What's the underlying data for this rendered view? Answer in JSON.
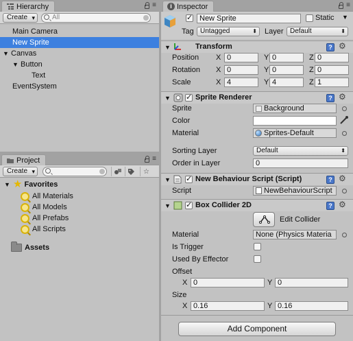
{
  "hierarchy": {
    "tab_label": "Hierarchy",
    "create_label": "Create",
    "search_placeholder": "All",
    "items": [
      {
        "label": "Main Camera",
        "indent": 0,
        "selected": false,
        "expander": ""
      },
      {
        "label": "New Sprite",
        "indent": 0,
        "selected": true,
        "expander": ""
      },
      {
        "label": "Canvas",
        "indent": 0,
        "selected": false,
        "expander": "▼"
      },
      {
        "label": "Button",
        "indent": 1,
        "selected": false,
        "expander": "▼"
      },
      {
        "label": "Text",
        "indent": 2,
        "selected": false,
        "expander": ""
      },
      {
        "label": "EventSystem",
        "indent": 0,
        "selected": false,
        "expander": ""
      }
    ]
  },
  "project": {
    "tab_label": "Project",
    "create_label": "Create",
    "favorites_label": "Favorites",
    "favorites": [
      "All Materials",
      "All Models",
      "All Prefabs",
      "All Scripts"
    ],
    "assets_label": "Assets"
  },
  "inspector": {
    "tab_label": "Inspector",
    "object_name": "New Sprite",
    "static_label": "Static",
    "tag_label": "Tag",
    "tag_value": "Untagged",
    "layer_label": "Layer",
    "layer_value": "Default",
    "transform": {
      "title": "Transform",
      "position_label": "Position",
      "rotation_label": "Rotation",
      "scale_label": "Scale",
      "position": {
        "x": "0",
        "y": "0",
        "z": "0"
      },
      "rotation": {
        "x": "0",
        "y": "0",
        "z": "0"
      },
      "scale": {
        "x": "4",
        "y": "4",
        "z": "1"
      }
    },
    "sprite_renderer": {
      "title": "Sprite Renderer",
      "sprite_label": "Sprite",
      "sprite_value": "Background",
      "color_label": "Color",
      "color_value": "#ffffff",
      "material_label": "Material",
      "material_value": "Sprites-Default",
      "sorting_layer_label": "Sorting Layer",
      "sorting_layer_value": "Default",
      "order_label": "Order in Layer",
      "order_value": "0"
    },
    "script_comp": {
      "title": "New Behaviour Script (Script)",
      "script_label": "Script",
      "script_value": "NewBehaviourScript"
    },
    "box_collider": {
      "title": "Box Collider 2D",
      "edit_label": "Edit Collider",
      "material_label": "Material",
      "material_value": "None (Physics Materia",
      "is_trigger_label": "Is Trigger",
      "used_by_effector_label": "Used By Effector",
      "offset_label": "Offset",
      "offset": {
        "x": "0",
        "y": "0"
      },
      "size_label": "Size",
      "size": {
        "x": "0.16",
        "y": "0.16"
      }
    },
    "add_component_label": "Add Component"
  },
  "axis_labels": {
    "x": "X",
    "y": "Y",
    "z": "Z"
  }
}
